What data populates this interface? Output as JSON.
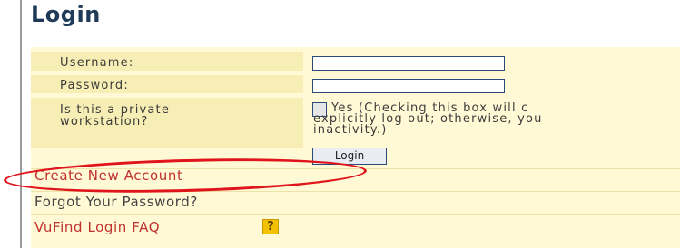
{
  "header": {
    "title": "Login"
  },
  "form": {
    "username_label": "Username:",
    "username_value": "",
    "password_label": "Password:",
    "password_value": "",
    "private_label": "Is this a private\nworkstation?",
    "private_checked": false,
    "private_note": "Yes (Checking this box will c\nexplicitly log out; otherwise, you\ninactivity.)",
    "login_button": "Login"
  },
  "links": {
    "create_account": "Create New Account",
    "forgot_password": "Forgot Your Password?",
    "login_faq": "VuFind Login FAQ",
    "faq_help_icon": "?"
  },
  "colors": {
    "title": "#1f3b57",
    "panel": "#fff9d6",
    "label_cell": "#f6eeb4",
    "create_link": "#c0322d",
    "forgot_link": "#444444",
    "faq_link": "#c0322d",
    "highlight": "#e0141b",
    "help_icon": "#f2c200"
  }
}
